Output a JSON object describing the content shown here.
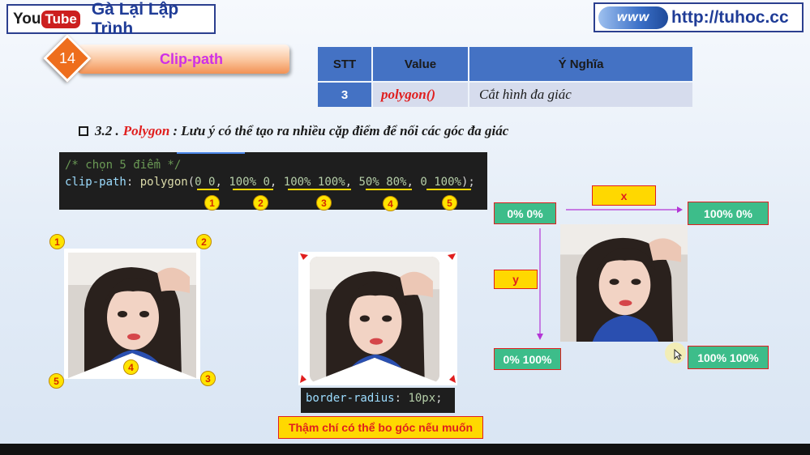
{
  "header": {
    "youtube_you": "You",
    "youtube_tube": "Tube",
    "channel_name": "Gà Lại Lập Trình",
    "www_text": "www",
    "site_url": "http://tuhoc.cc"
  },
  "topic": {
    "number": "14",
    "title": "Clip-path"
  },
  "table": {
    "headers": [
      "STT",
      "Value",
      "Ý Nghĩa"
    ],
    "row": {
      "stt": "3",
      "value": "polygon()",
      "meaning": "Cắt hình đa giác"
    }
  },
  "heading": {
    "prefix": "3.2 .",
    "keyword": "Polygon",
    "text": ": Lưu ý có thể tạo ra nhiều cặp điểm để nối các góc đa giác"
  },
  "code": {
    "comment": "/* chọn 5 điểm */",
    "prop": "clip-path",
    "func": "polygon",
    "points": [
      "0 0",
      "100% 0",
      "100% 100%",
      "50% 80%",
      "0 100%"
    ],
    "badges": [
      "1",
      "2",
      "3",
      "4",
      "5"
    ]
  },
  "corner_badges": {
    "tl": "1",
    "tr": "2",
    "br": "3",
    "mid": "4",
    "bl": "5"
  },
  "border_radius_code": {
    "prop": "border-radius",
    "value": "10px"
  },
  "note": "Thậm chí có thể bo góc nếu muốn",
  "coords": {
    "top_left": "0% 0%",
    "top_right": "100% 0%",
    "bottom_left": "0% 100%",
    "bottom_right": "100% 100%",
    "x_axis": "x",
    "y_axis": "y"
  },
  "colors": {
    "accent_orange": "#ee6e1d",
    "table_blue": "#4472c4",
    "label_green": "#3dbd8a",
    "label_yellow": "#ffd800",
    "text_red": "#e01e1e"
  }
}
